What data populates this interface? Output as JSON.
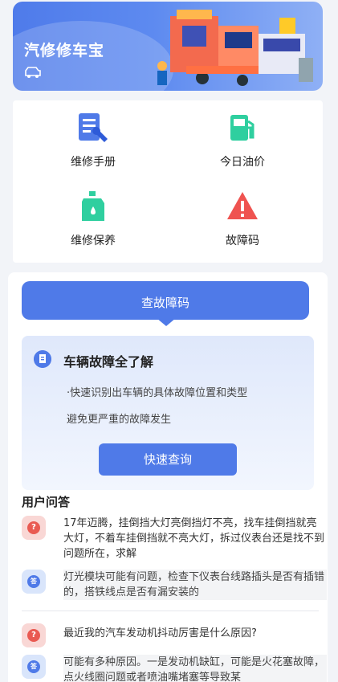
{
  "banner": {
    "title": "汽修修车宝",
    "car_icon": "car-icon"
  },
  "menu": {
    "items": [
      {
        "label": "维修手册",
        "icon": "manual-wrench-icon",
        "color": "#4f7ae8"
      },
      {
        "label": "今日油价",
        "icon": "fuel-pump-icon",
        "color": "#2fcf9f"
      },
      {
        "label": "维修保养",
        "icon": "oil-bottle-icon",
        "color": "#2fcf9f"
      },
      {
        "label": "故障码",
        "icon": "warning-icon",
        "color": "#ef5350"
      }
    ]
  },
  "fault": {
    "tab_label": "查故障码",
    "info_title": "车辆故障全了解",
    "info_line1": "·快速识别出车辆的具体故障位置和类型",
    "info_line2": "避免更严重的故障发生",
    "button_label": "快速查询"
  },
  "qa": {
    "title": "用户问答",
    "items": [
      {
        "question": "17年迈腾，挂倒挡大灯亮倒挡灯不亮，找车挂倒挡就亮大灯，不着车挂倒挡就不亮大灯，拆过仪表台还是找不到问题所在，求解",
        "answer": "灯光模块可能有问题，检查下仪表台线路插头是否有插错的，搭铁线点是否有漏安装的"
      },
      {
        "question": "最近我的汽车发动机抖动厉害是什么原因?",
        "answer": "可能有多种原因。一是发动机缺缸，可能是火花塞故障，点火线圈问题或者喷油嘴堵塞等导致某"
      }
    ],
    "question_badge": "?",
    "answer_badge": "答"
  },
  "colors": {
    "accent": "#4f7ae8",
    "danger": "#e95a52",
    "green": "#2fcf9f"
  }
}
